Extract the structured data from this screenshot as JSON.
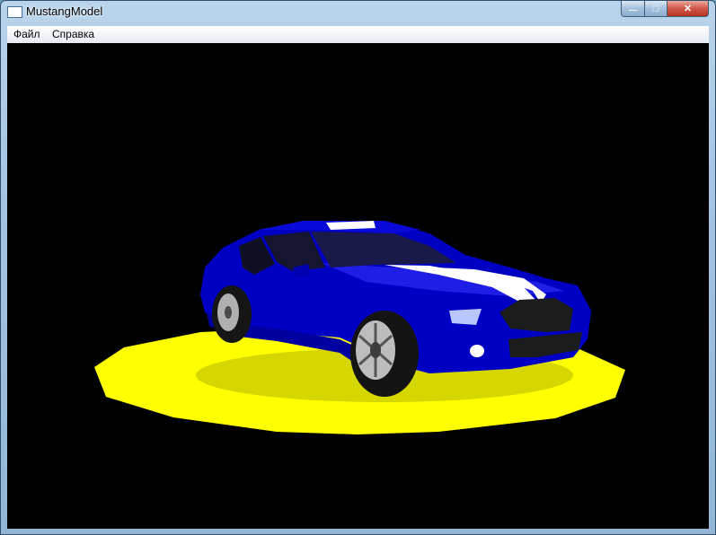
{
  "window": {
    "title": "MustangModel"
  },
  "controls": {
    "minimize": "—",
    "maximize": "□",
    "close": "✕"
  },
  "menu": {
    "items": [
      {
        "label": "Файл"
      },
      {
        "label": "Справка"
      }
    ]
  },
  "scene": {
    "background": "#000000",
    "platform_color": "#ffff00",
    "car_color": "#0000cc",
    "stripe_color": "#ffffff"
  }
}
